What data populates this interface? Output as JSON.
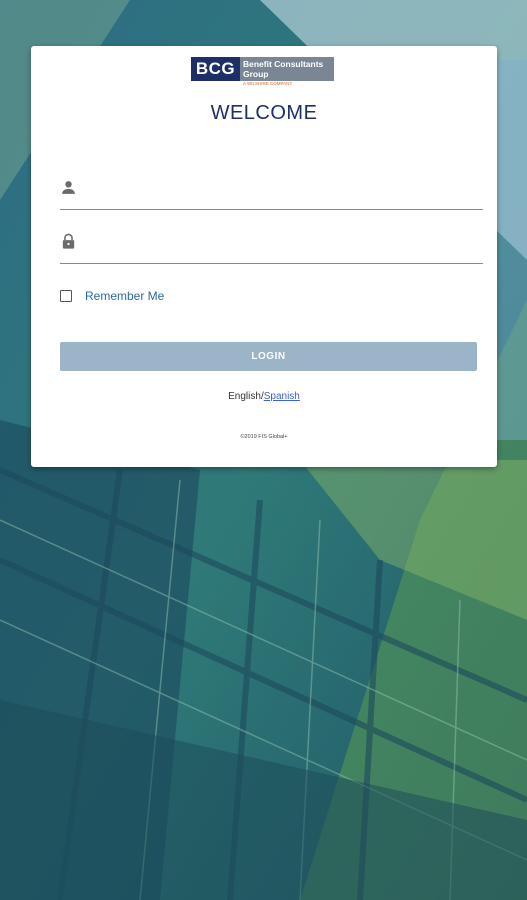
{
  "logo": {
    "abbrev": "BCG",
    "name": "Benefit Consultants Group",
    "tagline": "A WILSHIRE COMPANY"
  },
  "heading": "WELCOME",
  "form": {
    "username_placeholder": "",
    "password_placeholder": "",
    "remember_label": "Remember Me",
    "login_label": "LOGIN"
  },
  "language": {
    "english": "English",
    "separator": "/",
    "spanish": "Spanish"
  },
  "footer": {
    "copyright": "©2019 FIS Global+"
  },
  "colors": {
    "brand_navy": "#1d2f66",
    "login_button": "#9cb4c8",
    "link_blue": "#3b5fd6"
  },
  "icons": {
    "username": "user-icon",
    "password": "lock-icon"
  }
}
